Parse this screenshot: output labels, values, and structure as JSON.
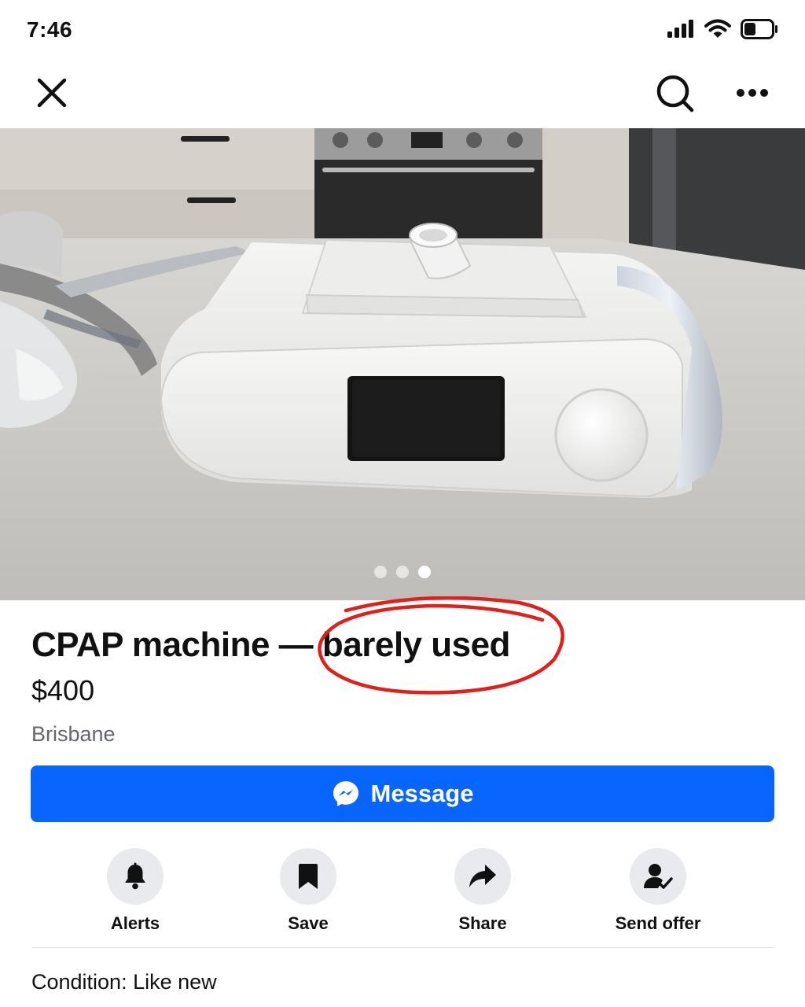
{
  "status_bar": {
    "time": "7:46"
  },
  "listing": {
    "title": "CPAP machine — barely used",
    "price": "$400",
    "location": "Brisbane",
    "condition": "Condition: Like new"
  },
  "photo": {
    "count": 3,
    "active_index": 2
  },
  "message_button": {
    "label": "Message"
  },
  "actions": [
    {
      "label": "Alerts",
      "icon": "bell-icon"
    },
    {
      "label": "Save",
      "icon": "bookmark-icon"
    },
    {
      "label": "Share",
      "icon": "share-arrow-icon"
    },
    {
      "label": "Send offer",
      "icon": "person-check-icon"
    }
  ],
  "colors": {
    "accent": "#0866ff",
    "annotation": "#e0201c",
    "muted_text": "#65676b"
  }
}
